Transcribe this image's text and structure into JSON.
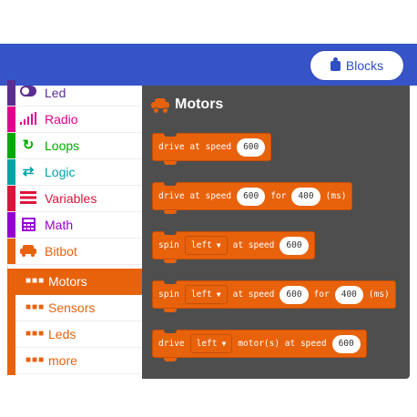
{
  "header": {
    "blocks_label": "Blocks"
  },
  "toolbox": {
    "categories": [
      {
        "label": "Led",
        "color": "#5c2d91",
        "icon": "toggle-icon"
      },
      {
        "label": "Radio",
        "color": "#e3008c",
        "icon": "signal-icon"
      },
      {
        "label": "Loops",
        "color": "#00aa00",
        "icon": "refresh-icon"
      },
      {
        "label": "Logic",
        "color": "#00a4a6",
        "icon": "shuffle-icon"
      },
      {
        "label": "Variables",
        "color": "#dc143c",
        "icon": "list-icon"
      },
      {
        "label": "Math",
        "color": "#9400d3",
        "icon": "calculator-icon"
      },
      {
        "label": "Bitbot",
        "color": "#e8620c",
        "icon": "car-icon"
      }
    ],
    "subcategories": [
      {
        "label": "Motors",
        "selected": true
      },
      {
        "label": "Sensors",
        "selected": false
      },
      {
        "label": "Leds",
        "selected": false
      },
      {
        "label": "more",
        "selected": false
      }
    ]
  },
  "flyout": {
    "title": "Motors",
    "accent": "#e8620c",
    "blocks": [
      {
        "text1": "drive at speed",
        "value1": "600"
      },
      {
        "text1": "drive at speed",
        "value1": "600",
        "text2": "for",
        "value2": "400",
        "text3": "(ms)"
      },
      {
        "text1": "spin",
        "drop": "left",
        "text2": "at speed",
        "value1": "600"
      },
      {
        "text1": "spin",
        "drop": "left",
        "text2": "at speed",
        "value1": "600",
        "text3": "for",
        "value2": "400",
        "text4": "(ms)"
      },
      {
        "text1": "drive",
        "drop": "left",
        "text2": "motor(s) at speed",
        "value1": "600"
      }
    ]
  }
}
